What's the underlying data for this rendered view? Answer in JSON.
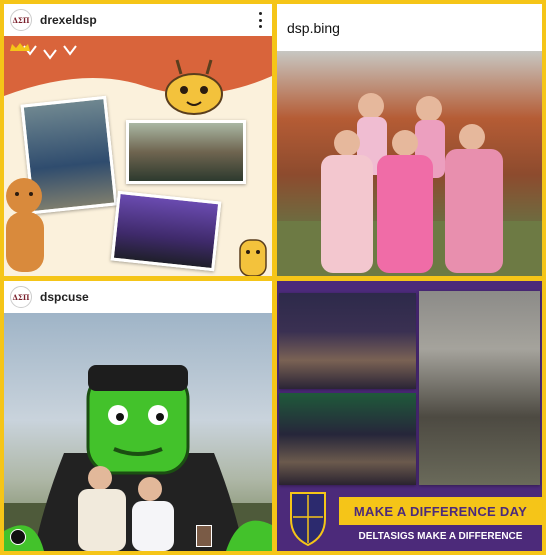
{
  "posts": [
    {
      "username": "drexeldsp",
      "avatar_text": "ΔΣΠ"
    },
    {
      "username": "dsp.bing"
    },
    {
      "username": "dspcuse",
      "avatar_text": "ΔΣΠ"
    },
    {
      "banner_title": "MAKE A DIFFERENCE DAY",
      "banner_subtitle": "DELTASIGS MAKE A DIFFERENCE"
    }
  ],
  "colors": {
    "frame_yellow": "#f5c518",
    "brand_purple": "#4c2a7a"
  },
  "icons": {
    "more": "more-vertical-icon"
  }
}
